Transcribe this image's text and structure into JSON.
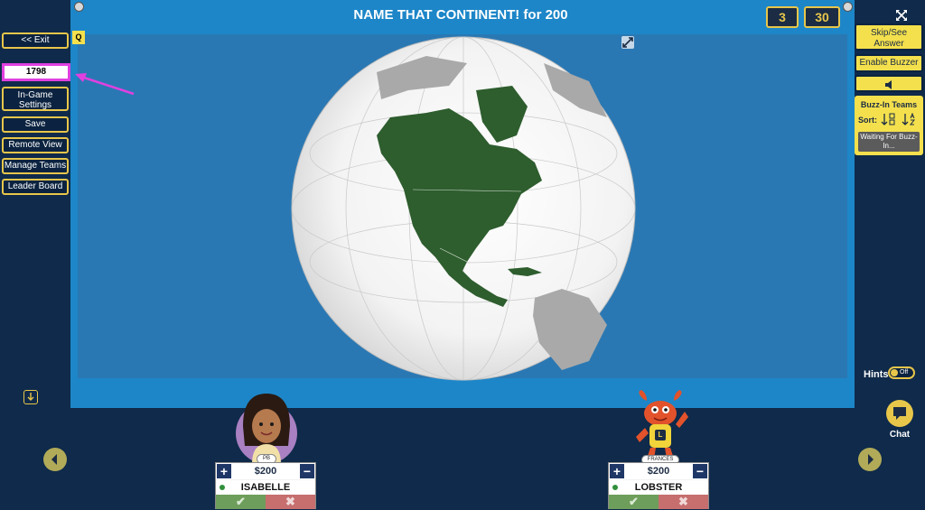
{
  "header": {
    "title": "NAME THAT CONTINENT! for 200",
    "counter_left": "3",
    "counter_right": "30",
    "q_badge": "Q"
  },
  "left_sidebar": {
    "exit_label": "<< Exit",
    "code_value": "1798",
    "in_game_settings_label": "In-Game Settings",
    "save_label": "Save",
    "remote_view_label": "Remote View",
    "manage_teams_label": "Manage Teams",
    "leader_board_label": "Leader Board"
  },
  "right_sidebar": {
    "skip_label": "Skip/See Answer",
    "enable_buzzer_label": "Enable Buzzer",
    "buzz_in_title": "Buzz-In Teams",
    "sort_label": "Sort:",
    "waiting_label": "Waiting For Buzz-In..."
  },
  "hints": {
    "label": "Hints",
    "toggle_state": "Off"
  },
  "chat": {
    "label": "Chat"
  },
  "teams": [
    {
      "score": "$200",
      "name": "ISABELLE",
      "tag": "PB"
    },
    {
      "score": "$200",
      "name": "LOBSTER",
      "tag": "FRANCES",
      "badge": "L"
    }
  ],
  "colors": {
    "accent_yellow": "#f4e04d",
    "stage_blue": "#1d86c8",
    "background_navy": "#0f2a4a",
    "highlight_magenta": "#e040e0",
    "continent_green": "#2e5d2e"
  }
}
